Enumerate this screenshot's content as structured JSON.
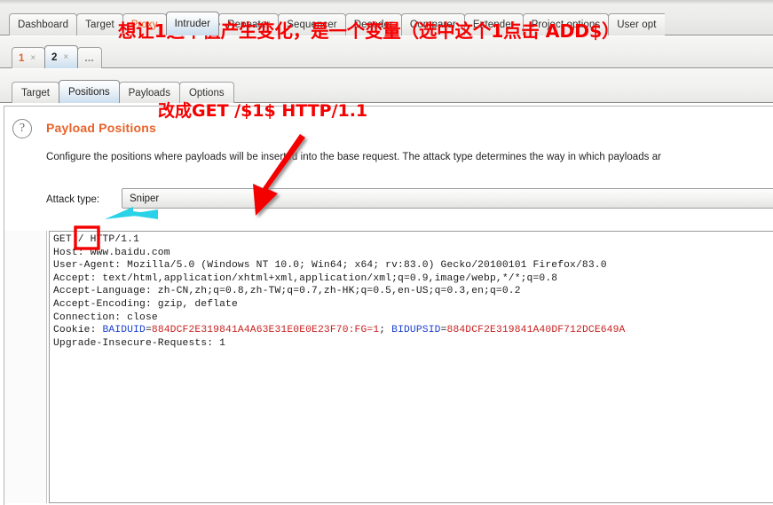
{
  "window": {
    "app": "Burp Suite",
    "accent_orange": "#e8622a",
    "annotation_red": "#f40000",
    "annotation_cyan": "#2ad2e8",
    "selected_tab_blue": "#cbdeee"
  },
  "main_tabs": [
    {
      "label": "Dashboard",
      "state": "normal"
    },
    {
      "label": "Target",
      "state": "normal"
    },
    {
      "label": "Proxy",
      "state": "alert"
    },
    {
      "label": "Intruder",
      "state": "active"
    },
    {
      "label": "Repeater",
      "state": "normal"
    },
    {
      "label": "Sequencer",
      "state": "normal"
    },
    {
      "label": "Decoder",
      "state": "normal"
    },
    {
      "label": "Comparer",
      "state": "normal"
    },
    {
      "label": "Extender",
      "state": "normal"
    },
    {
      "label": "Project options",
      "state": "normal"
    },
    {
      "label": "User opt",
      "state": "clipped"
    }
  ],
  "attack_tabs": [
    {
      "label": "1",
      "close": "×",
      "state": "alert"
    },
    {
      "label": "2",
      "close": "×",
      "state": "active"
    },
    {
      "label": "…",
      "close": "",
      "state": "add"
    }
  ],
  "intruder_tabs": [
    {
      "label": "Target",
      "state": "normal"
    },
    {
      "label": "Positions",
      "state": "active"
    },
    {
      "label": "Payloads",
      "state": "normal"
    },
    {
      "label": "Options",
      "state": "normal"
    }
  ],
  "positions_panel": {
    "help_glyph": "?",
    "title": "Payload Positions",
    "description": "Configure the positions where payloads will be inserted into the base request. The attack type determines the way in which payloads ar",
    "attack_type_label": "Attack type:",
    "attack_type_value": "Sniper"
  },
  "request": {
    "line1_method": "GET",
    "line1_path": "/",
    "line1_proto": "HTTP/1.1",
    "lines": [
      "Host: www.baidu.com",
      "User-Agent: Mozilla/5.0 (Windows NT 10.0; Win64; x64; rv:83.0) Gecko/20100101 Firefox/83.0",
      "Accept: text/html,application/xhtml+xml,application/xml;q=0.9,image/webp,*/*;q=0.8",
      "Accept-Language: zh-CN,zh;q=0.8,zh-TW;q=0.7,zh-HK;q=0.5,en-US;q=0.3,en;q=0.2",
      "Accept-Encoding: gzip, deflate",
      "Connection: close"
    ],
    "cookie_prefix": "Cookie: ",
    "cookie_name_1": "BAIDUID",
    "cookie_val_1": "884DCF2E319841A4A63E31E0E0E23F70:FG=1",
    "cookie_sep": "; ",
    "cookie_name_2": "BIDUPSID",
    "cookie_val_2": "884DCF2E319841A40DF712DCE649A",
    "last_line": "Upgrade-Insecure-Requests: 1"
  },
  "annotations": {
    "top_note": "想让1这个值产生变化，是一个变量（选中这个1点击 ADD$）",
    "bottom_note": "改成GET /$1$ HTTP/1.1"
  }
}
